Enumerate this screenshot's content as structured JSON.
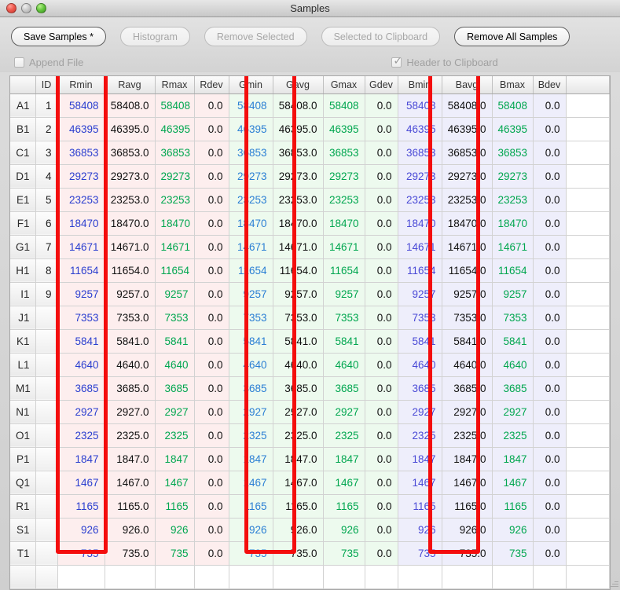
{
  "window": {
    "title": "Samples",
    "traffic_lights": [
      "close-button",
      "minimize-button",
      "zoom-button"
    ]
  },
  "toolbar": {
    "buttons": [
      {
        "label": "Save Samples *",
        "enabled": true
      },
      {
        "label": "Histogram",
        "enabled": false
      },
      {
        "label": "Remove Selected",
        "enabled": false
      },
      {
        "label": "Selected to Clipboard",
        "enabled": false
      },
      {
        "label": "Remove All Samples",
        "enabled": true
      }
    ],
    "checkboxes": [
      {
        "label": "Append File",
        "checked": false,
        "enabled": false
      },
      {
        "label": "Header to Clipboard",
        "checked": true,
        "enabled": false
      }
    ]
  },
  "colors": {
    "red_group_bg": "#fdeeee",
    "green_group_bg": "#edfaee",
    "blue_group_bg": "#eeeefb",
    "min_value_text": "#2b3ecf",
    "max_value_text": "#00a64f",
    "avg_value_text": "#111111",
    "annotation_box": "#f40d0d"
  },
  "table": {
    "columns": [
      {
        "key": "row",
        "label": "",
        "group": "hdr"
      },
      {
        "key": "id",
        "label": "ID",
        "group": "id"
      },
      {
        "key": "rmin",
        "label": "Rmin",
        "group": "R"
      },
      {
        "key": "ravg",
        "label": "Ravg",
        "group": "R"
      },
      {
        "key": "rmax",
        "label": "Rmax",
        "group": "R"
      },
      {
        "key": "rdev",
        "label": "Rdev",
        "group": "R"
      },
      {
        "key": "gmin",
        "label": "Gmin",
        "group": "G"
      },
      {
        "key": "gavg",
        "label": "Gavg",
        "group": "G"
      },
      {
        "key": "gmax",
        "label": "Gmax",
        "group": "G"
      },
      {
        "key": "gdev",
        "label": "Gdev",
        "group": "G"
      },
      {
        "key": "bmin",
        "label": "Bmin",
        "group": "B"
      },
      {
        "key": "bavg",
        "label": "Bavg",
        "group": "B"
      },
      {
        "key": "bmax",
        "label": "Bmax",
        "group": "B"
      },
      {
        "key": "bdev",
        "label": "Bdev",
        "group": "B"
      }
    ],
    "highlighted_columns": [
      "Ravg",
      "Gavg",
      "Bavg"
    ],
    "rows": [
      {
        "row": "A1",
        "id": "1",
        "min": "58408",
        "avg": "58408.0",
        "dev": "0.0"
      },
      {
        "row": "B1",
        "id": "2",
        "min": "46395",
        "avg": "46395.0",
        "dev": "0.0"
      },
      {
        "row": "C1",
        "id": "3",
        "min": "36853",
        "avg": "36853.0",
        "dev": "0.0"
      },
      {
        "row": "D1",
        "id": "4",
        "min": "29273",
        "avg": "29273.0",
        "dev": "0.0"
      },
      {
        "row": "E1",
        "id": "5",
        "min": "23253",
        "avg": "23253.0",
        "dev": "0.0"
      },
      {
        "row": "F1",
        "id": "6",
        "min": "18470",
        "avg": "18470.0",
        "dev": "0.0"
      },
      {
        "row": "G1",
        "id": "7",
        "min": "14671",
        "avg": "14671.0",
        "dev": "0.0"
      },
      {
        "row": "H1",
        "id": "8",
        "min": "11654",
        "avg": "11654.0",
        "dev": "0.0"
      },
      {
        "row": "I1",
        "id": "9",
        "min": "9257",
        "avg": "9257.0",
        "dev": "0.0"
      },
      {
        "row": "J1",
        "id": "",
        "min": "7353",
        "avg": "7353.0",
        "dev": "0.0"
      },
      {
        "row": "K1",
        "id": "",
        "min": "5841",
        "avg": "5841.0",
        "dev": "0.0"
      },
      {
        "row": "L1",
        "id": "",
        "min": "4640",
        "avg": "4640.0",
        "dev": "0.0"
      },
      {
        "row": "M1",
        "id": "",
        "min": "3685",
        "avg": "3685.0",
        "dev": "0.0"
      },
      {
        "row": "N1",
        "id": "",
        "min": "2927",
        "avg": "2927.0",
        "dev": "0.0"
      },
      {
        "row": "O1",
        "id": "",
        "min": "2325",
        "avg": "2325.0",
        "dev": "0.0"
      },
      {
        "row": "P1",
        "id": "",
        "min": "1847",
        "avg": "1847.0",
        "dev": "0.0"
      },
      {
        "row": "Q1",
        "id": "",
        "min": "1467",
        "avg": "1467.0",
        "dev": "0.0"
      },
      {
        "row": "R1",
        "id": "",
        "min": "1165",
        "avg": "1165.0",
        "dev": "0.0"
      },
      {
        "row": "S1",
        "id": "",
        "min": "926",
        "avg": "926.0",
        "dev": "0.0"
      },
      {
        "row": "T1",
        "id": "",
        "min": "735",
        "avg": "735.0",
        "dev": "0.0"
      }
    ]
  }
}
